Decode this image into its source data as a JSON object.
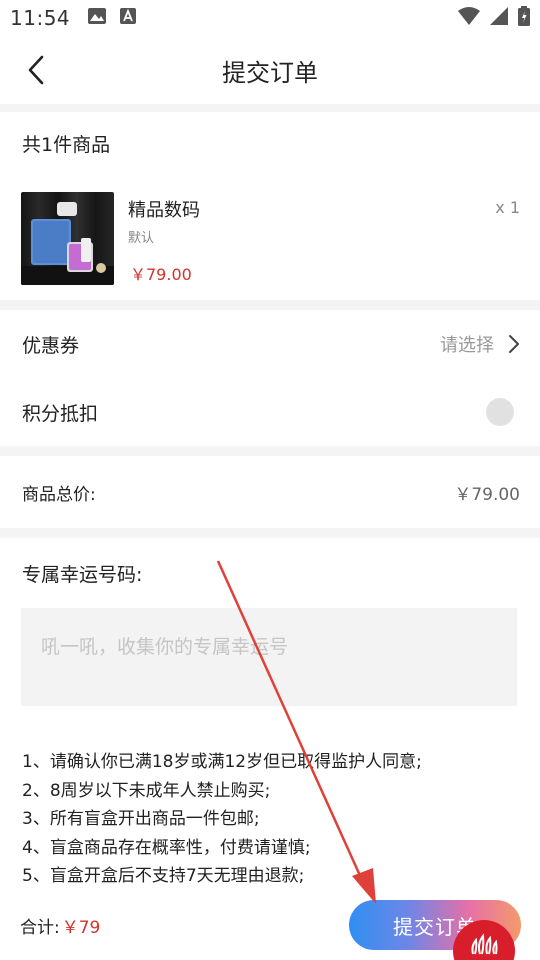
{
  "status_bar": {
    "time": "11:54",
    "left_icons": [
      "image-icon",
      "a-notification-icon"
    ],
    "right_icons": [
      "wifi-icon",
      "signal-icon",
      "battery-icon"
    ]
  },
  "nav": {
    "title": "提交订单",
    "back_icon": "chevron-left-icon"
  },
  "goods": {
    "count_label": "共1件商品",
    "items": [
      {
        "name": "精品数码",
        "spec": "默认",
        "price": "￥79.00",
        "qty": "x 1"
      }
    ]
  },
  "coupon": {
    "label": "优惠券",
    "value": "请选择"
  },
  "points": {
    "label": "积分抵扣",
    "enabled": false
  },
  "total": {
    "label": "商品总价:",
    "value": "￥79.00"
  },
  "lucky": {
    "title": "专属幸运号码:",
    "placeholder": "吼一吼，收集你的专属幸运号",
    "value": ""
  },
  "notes": [
    "1、请确认你已满18岁或满12岁但已取得监护人同意;",
    "2、8周岁以下未成年人禁止购买;",
    "3、所有盲盒开出商品一件包邮;",
    "4、盲盒商品存在概率性，付费请谨慎;",
    "5、盲盒开盒后不支持7天无理由退款;"
  ],
  "bottom": {
    "sum_label": "合计:",
    "sum_value": "￥79",
    "submit_label": "提交订单"
  },
  "colors": {
    "price_red": "#d7322a",
    "badge_red": "#d81e2a",
    "button_gradient": [
      "#2f8ff2",
      "#e770a6",
      "#f49a6b"
    ],
    "annotation_arrow": "#e0403a"
  }
}
